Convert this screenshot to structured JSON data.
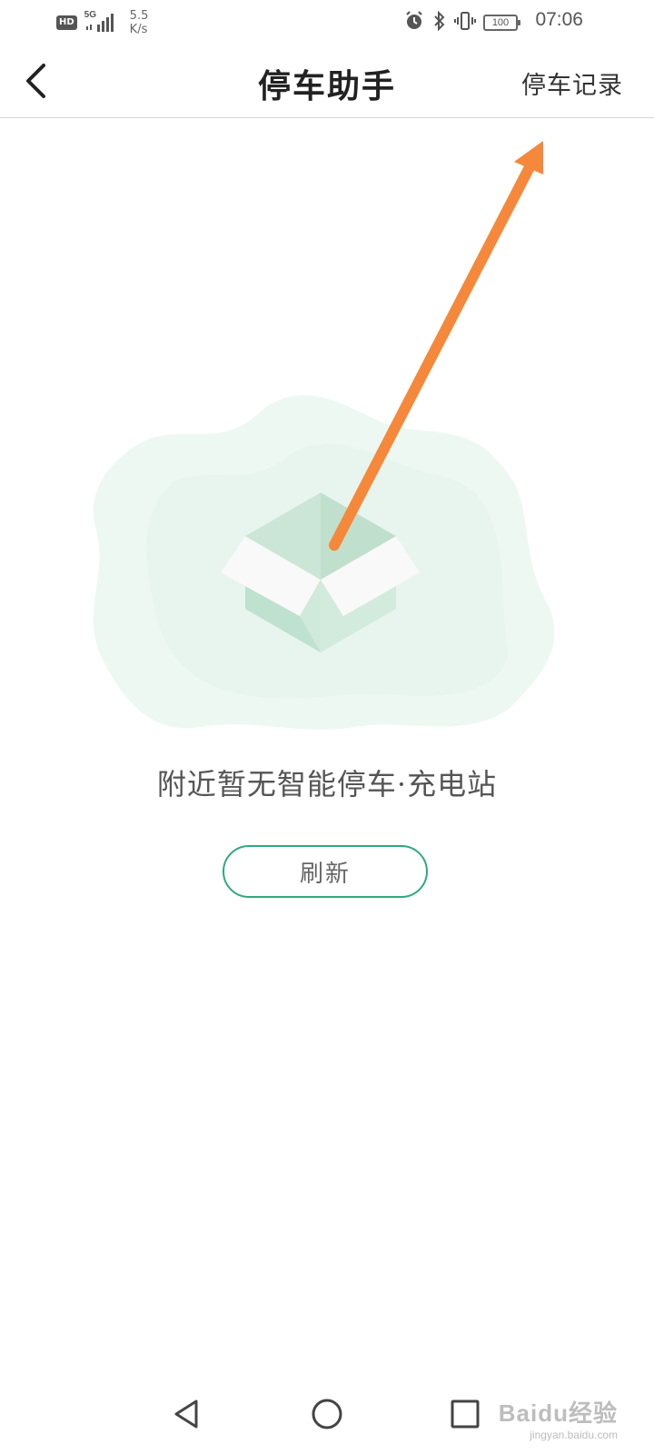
{
  "status_bar": {
    "hd_badge": "HD",
    "signal_label": "5G",
    "net_speed_value": "5.5",
    "net_speed_unit": "K/s",
    "battery_level": "100",
    "time": "07:06"
  },
  "header": {
    "title": "停车助手",
    "records_link": "停车记录"
  },
  "empty_state": {
    "message": "附近暂无智能停车·充电站",
    "refresh_label": "刷新"
  },
  "watermark": {
    "logo_text": "Baidu经验",
    "url": "jingyan.baidu.com"
  },
  "colors": {
    "accent": "#2fa97c",
    "arrow": "#f5883a",
    "illustration_bg": "#eef8f3",
    "box_green": "#bfe1cf"
  },
  "icons": {
    "back": "chevron-left-icon",
    "alarm": "alarm-icon",
    "bluetooth": "bluetooth-icon",
    "vibrate": "vibrate-icon",
    "nav_back": "triangle-back-icon",
    "nav_home": "circle-home-icon",
    "nav_recent": "square-recent-icon"
  }
}
